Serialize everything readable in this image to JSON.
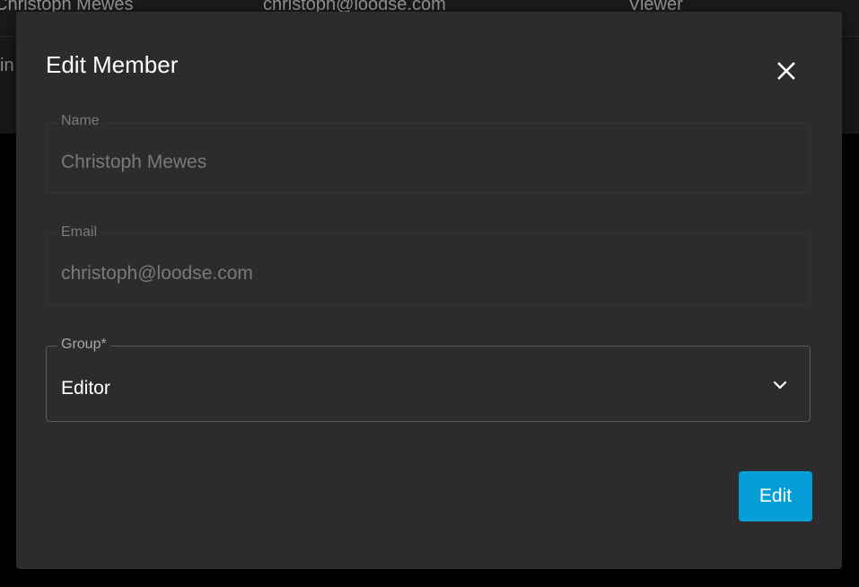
{
  "background_table": {
    "row1": {
      "name": "Christoph Mewes",
      "email": "christoph@loodse.com",
      "group": "Viewer"
    },
    "row2": {
      "fragment": "in"
    }
  },
  "modal": {
    "title": "Edit Member",
    "close_icon": "close-icon",
    "name_field": {
      "label": "Name",
      "value": "Christoph Mewes"
    },
    "email_field": {
      "label": "Email",
      "value": "christoph@loodse.com"
    },
    "group_field": {
      "label": "Group*",
      "value": "Editor",
      "icon": "chevron-down-icon"
    },
    "submit_label": "Edit"
  },
  "colors": {
    "accent": "#059ed9",
    "modal_bg": "#2c2c2c",
    "backdrop": "#000000"
  }
}
